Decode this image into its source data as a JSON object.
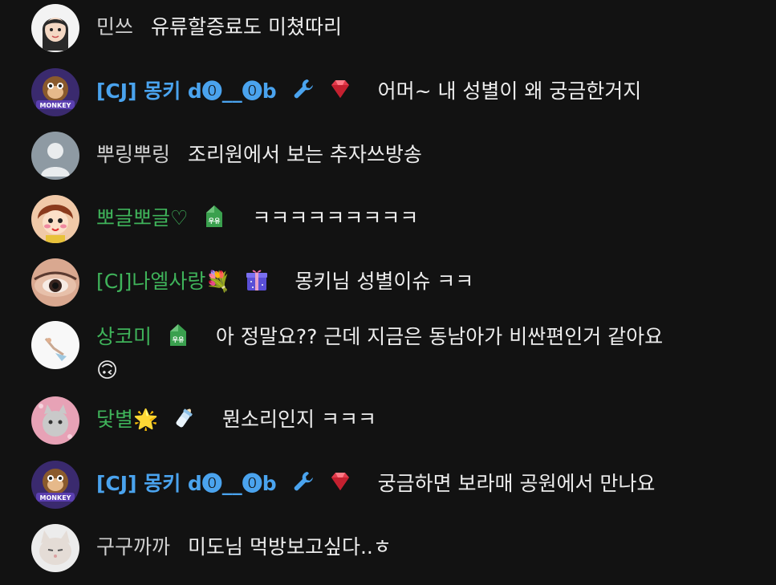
{
  "messages": [
    {
      "nick": "민쓰",
      "text": "유류할증료도 미쳤따리"
    },
    {
      "nick": "[CJ] 몽키 d⓿__⓿b",
      "text": "어머~ 내 성별이 왜 궁금한거지"
    },
    {
      "nick": "뿌링뿌링",
      "text": "조리원에서 보는 추자쓰방송"
    },
    {
      "nick": "뽀글뽀글♡",
      "text": "ㅋㅋㅋㅋㅋㅋㅋㅋㅋ"
    },
    {
      "nick": "[CJ]나엘사랑💐",
      "text": "몽키님 성별이슈 ㅋㅋ"
    },
    {
      "nick": "상코미",
      "text": "아 정말요?? 근데 지금은 동남아가 비싼편인거 같아요",
      "emoji": "🙃"
    },
    {
      "nick": "닻별🌟",
      "text": "뭔소리인지 ㅋㅋㅋ"
    },
    {
      "nick": "[CJ] 몽키 d⓿__⓿b",
      "text": "궁금하면 보라매 공원에서 만나요"
    },
    {
      "nick": "구구까까",
      "text": "미도님 먹방보고싶다..ㅎ"
    }
  ],
  "badge_labels": {
    "milk": "우유"
  },
  "avatar_labels": {
    "monkey": "MONKEY"
  },
  "colors": {
    "background": "#121212",
    "nick_gray": "#cfcfcf",
    "nick_blue": "#4aa3ee",
    "nick_green": "#3fb35a",
    "text": "#ededed"
  },
  "icons": {
    "wrench": "wrench-icon",
    "diamond": "diamond-icon",
    "milk": "milk-carton-icon",
    "gift": "gift-box-icon",
    "bottle": "baby-bottle-icon"
  }
}
